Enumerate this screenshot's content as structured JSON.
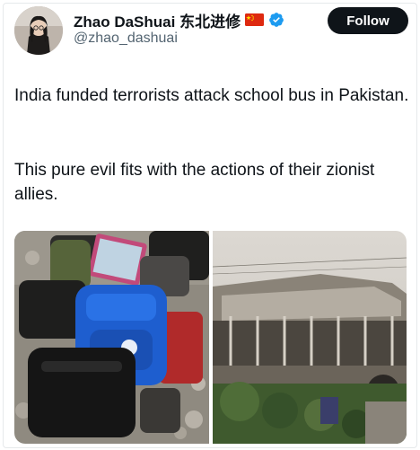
{
  "tweet": {
    "author": {
      "display_name": "Zhao DaShuai 东北进修",
      "handle": "@zhao_dashuai",
      "flag_icon": "china-flag-icon",
      "verified_icon": "verified-badge-icon",
      "verified_color": "#1d9bf0"
    },
    "follow_label": "Follow",
    "text": {
      "paragraph_1": "India funded terrorists attack school bus in Pakistan.",
      "paragraph_2": "This pure evil fits with the actions of their zionist allies."
    },
    "media": [
      {
        "name": "photo-bags"
      },
      {
        "name": "photo-burnt-bus"
      }
    ]
  }
}
